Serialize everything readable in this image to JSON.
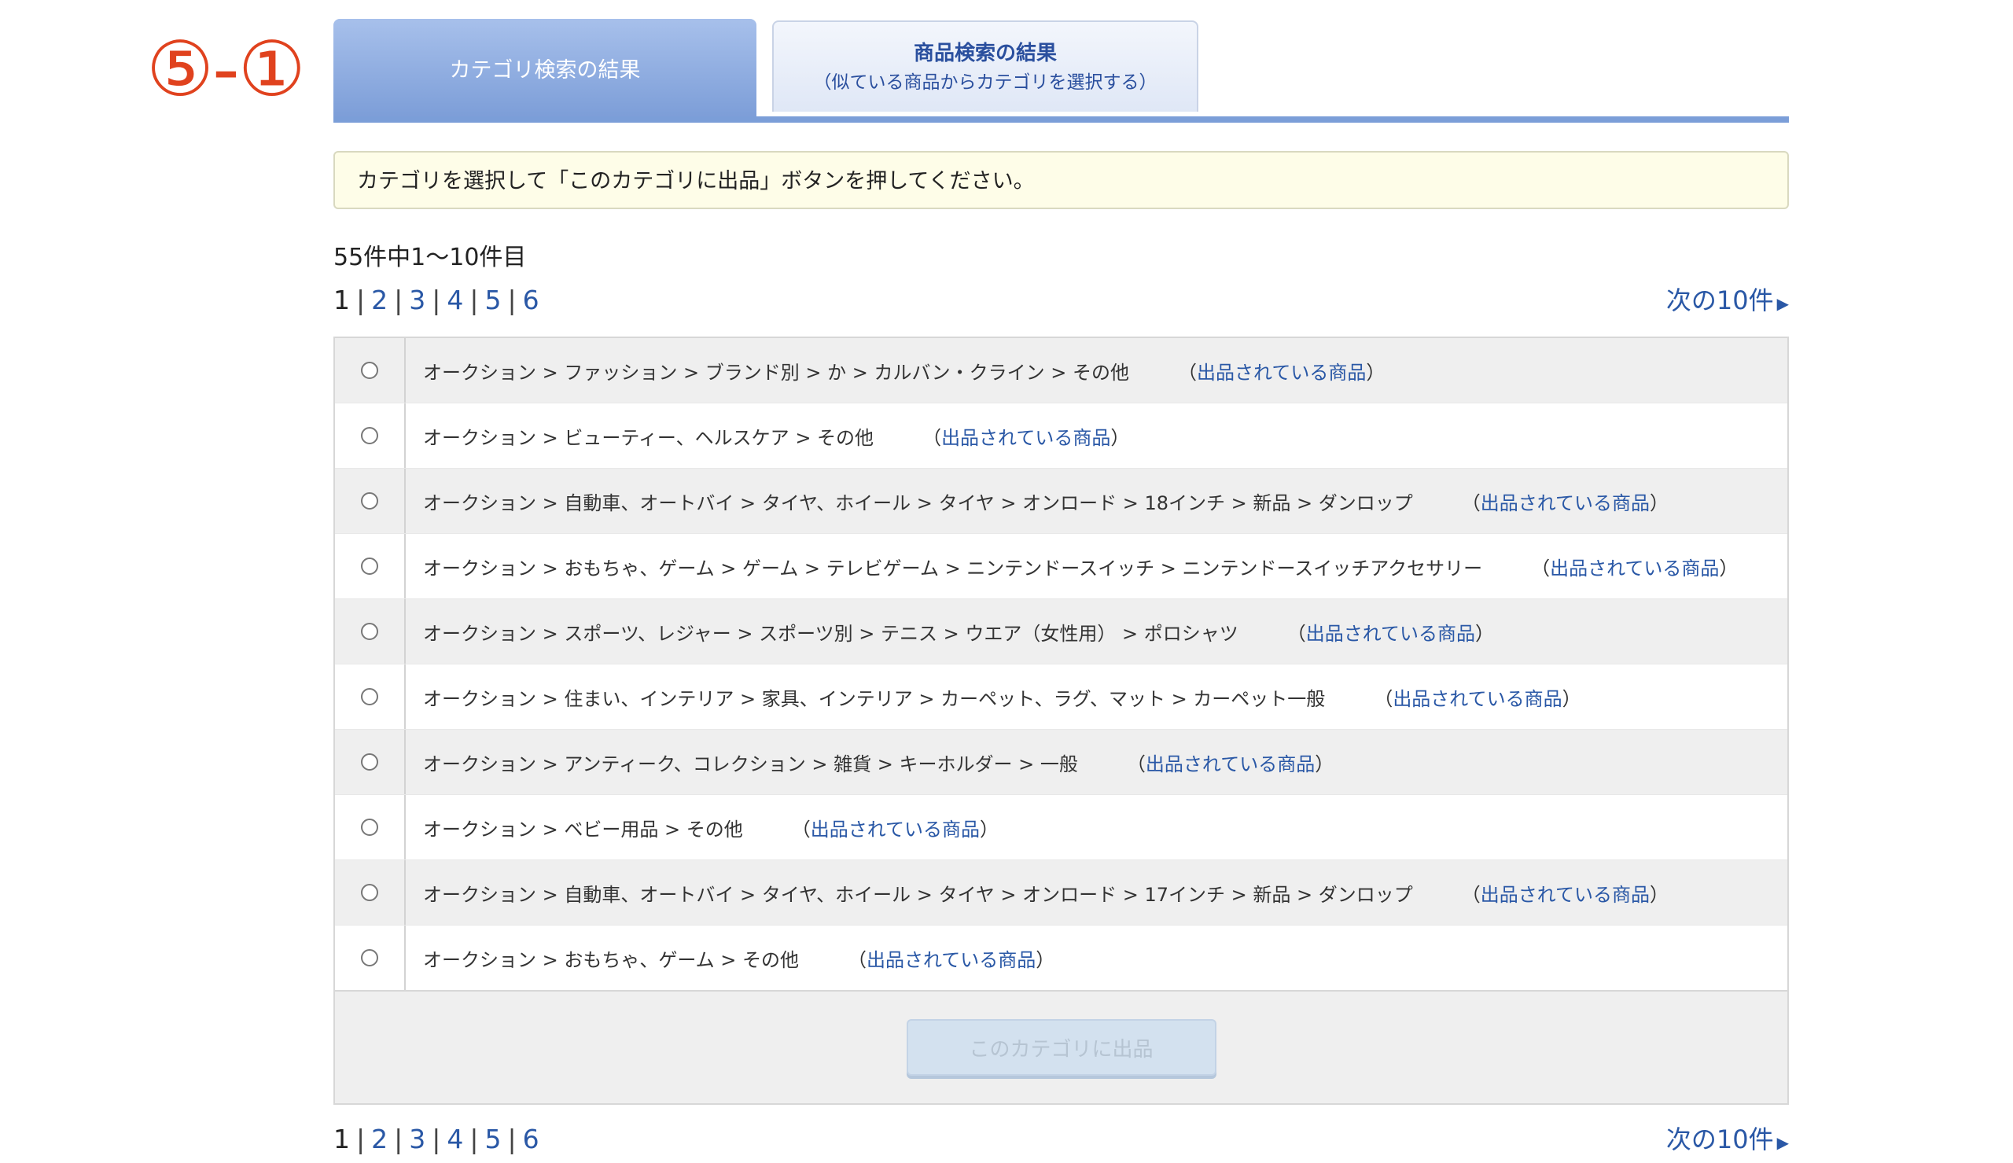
{
  "step_label": "⑤-①",
  "tabs": [
    {
      "label": "カテゴリ検索の結果",
      "sub": ""
    },
    {
      "label": "商品検索の結果",
      "sub": "（似ている商品からカテゴリを選択する）"
    }
  ],
  "notice": "カテゴリを選択して「このカテゴリに出品」ボタンを押してください。",
  "count_text": "55件中1〜10件目",
  "pager": {
    "current": "1",
    "pages": [
      "2",
      "3",
      "4",
      "5",
      "6"
    ],
    "next": "次の10件"
  },
  "link_label": "出品されている商品",
  "rows": [
    {
      "path": "オークション > ファッション > ブランド別 > か > カルバン・クライン > その他"
    },
    {
      "path": "オークション > ビューティー、ヘルスケア > その他"
    },
    {
      "path": "オークション > 自動車、オートバイ > タイヤ、ホイール > タイヤ > オンロード > 18インチ > 新品 > ダンロップ"
    },
    {
      "path": "オークション > おもちゃ、ゲーム > ゲーム > テレビゲーム > ニンテンドースイッチ > ニンテンドースイッチアクセサリー"
    },
    {
      "path": "オークション > スポーツ、レジャー > スポーツ別 > テニス > ウエア（女性用） > ポロシャツ"
    },
    {
      "path": "オークション > 住まい、インテリア > 家具、インテリア > カーペット、ラグ、マット > カーペット一般"
    },
    {
      "path": "オークション > アンティーク、コレクション > 雑貨 > キーホルダー > 一般"
    },
    {
      "path": "オークション > ベビー用品 > その他"
    },
    {
      "path": "オークション > 自動車、オートバイ > タイヤ、ホイール > タイヤ > オンロード > 17インチ > 新品 > ダンロップ"
    },
    {
      "path": "オークション > おもちゃ、ゲーム > その他"
    }
  ],
  "submit_label": "このカテゴリに出品"
}
